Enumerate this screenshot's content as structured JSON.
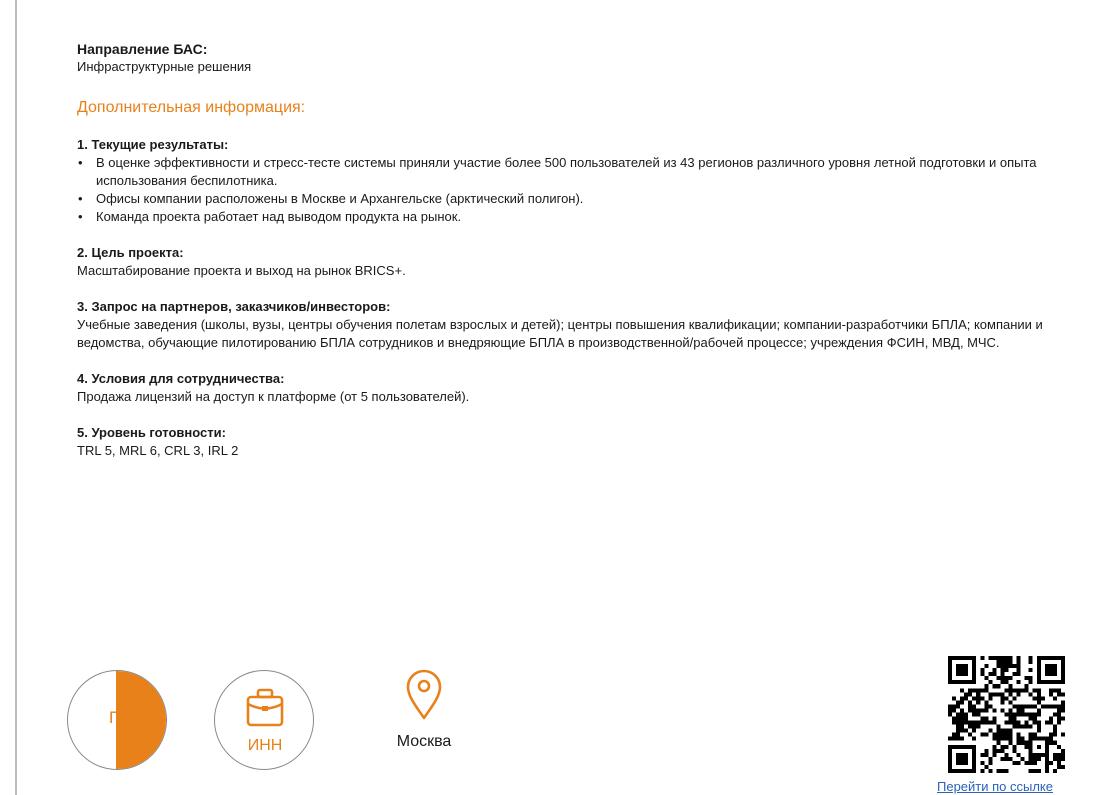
{
  "direction": {
    "label": "Направление БАС:",
    "value": "Инфраструктурные решения"
  },
  "additional_heading": "Дополнительная информация:",
  "sections": {
    "results": {
      "title": "1. Текущие результаты:",
      "bullets": [
        "В оценке эффективности и стресс-тесте системы приняли участие более 500 пользователей из 43 регионов различного уровня летной подготовки и опыта использования беспилотника.",
        "Офисы компании расположены в Москве и Архангельске (арктический полигон).",
        "Команда проекта работает над выводом продукта на рынок."
      ]
    },
    "goal": {
      "title": "2. Цель проекта:",
      "text": "Масштабирование проекта и выход на рынок BRICS+."
    },
    "partners": {
      "title": "3. Запрос на партнеров, заказчиков/инвесторов:",
      "text": "Учебные заведения (школы, вузы, центры обучения полетам взрослых и детей); центры повышения квалификации; компании-разработчики БПЛА; компании и ведомства, обучающие пилотированию БПЛА сотрудников и внедряющие БПЛА в производственной/рабочей процессе; учреждения ФСИН, МВД, МЧС."
    },
    "conditions": {
      "title": "4. Условия для сотрудничества:",
      "text": "Продажа лицензий на доступ к платформе (от 5 пользователей)."
    },
    "readiness": {
      "title": "5. Уровень готовности:",
      "text": "TRL 5, MRL 6, CRL 3, IRL 2"
    }
  },
  "badges": {
    "p_letter": "П",
    "inn_label": "ИНН",
    "briefcase_icon": "briefcase-icon",
    "location_icon": "map-pin-icon"
  },
  "location": {
    "city": "Москва"
  },
  "qr": {
    "link_text": "Перейти по ссылке"
  },
  "colors": {
    "accent": "#e8811a",
    "link": "#2a63b8",
    "text": "#1a1a1a",
    "border": "#8a8a8a"
  }
}
